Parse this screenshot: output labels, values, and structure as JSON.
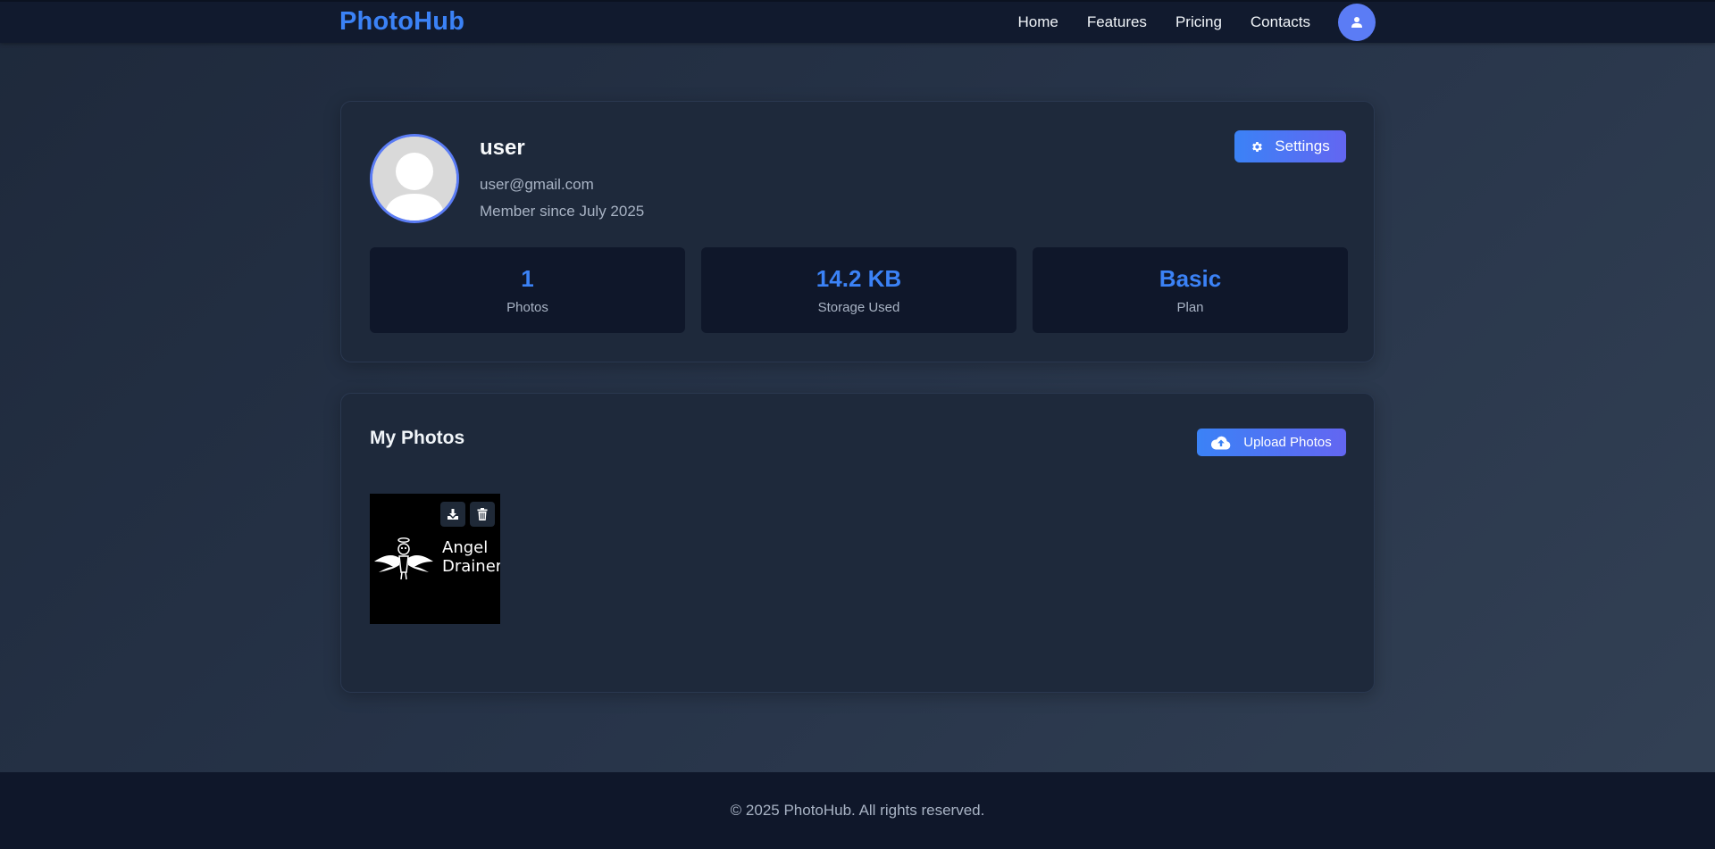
{
  "brand": {
    "logo": "PhotoHub",
    "accent": "#3b82f6"
  },
  "nav": {
    "links": [
      "Home",
      "Features",
      "Pricing",
      "Contacts"
    ],
    "avatar_icon": "user-icon"
  },
  "profile": {
    "name": "user",
    "email": "user@gmail.com",
    "member_since": "Member since July 2025",
    "settings_label": "Settings",
    "settings_icon": "gear-icon"
  },
  "stats": [
    {
      "value": "1",
      "label": "Photos"
    },
    {
      "value": "14.2 KB",
      "label": "Storage Used"
    },
    {
      "value": "Basic",
      "label": "Plan"
    }
  ],
  "photos_section": {
    "title": "My Photos",
    "upload_label": "Upload Photos",
    "upload_icon": "cloud-upload-icon",
    "photos": [
      {
        "caption_line1": "Angel",
        "caption_line2": "Drainer",
        "actions": [
          "download-icon",
          "trash-icon"
        ]
      }
    ]
  },
  "footer": {
    "text": "© 2025 PhotoHub. All rights reserved."
  }
}
